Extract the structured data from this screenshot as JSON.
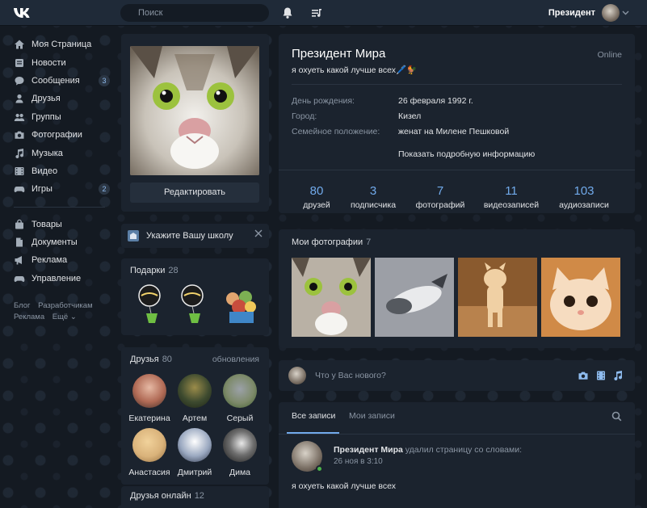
{
  "header": {
    "search_placeholder": "Поиск",
    "profile_name": "Президент"
  },
  "sidebar": {
    "items": [
      {
        "label": "Моя Страница",
        "icon": "home-icon"
      },
      {
        "label": "Новости",
        "icon": "news-icon"
      },
      {
        "label": "Сообщения",
        "icon": "messages-icon",
        "badge": "3"
      },
      {
        "label": "Друзья",
        "icon": "person-icon"
      },
      {
        "label": "Группы",
        "icon": "groups-icon"
      },
      {
        "label": "Фотографии",
        "icon": "camera-icon"
      },
      {
        "label": "Музыка",
        "icon": "music-icon"
      },
      {
        "label": "Видео",
        "icon": "video-icon"
      },
      {
        "label": "Игры",
        "icon": "gamepad-icon",
        "badge": "2"
      }
    ],
    "items2": [
      {
        "label": "Товары",
        "icon": "bag-icon"
      },
      {
        "label": "Документы",
        "icon": "document-icon"
      },
      {
        "label": "Реклама",
        "icon": "megaphone-icon"
      },
      {
        "label": "Управление",
        "icon": "gamepad-icon"
      }
    ],
    "footer": {
      "blog": "Блог",
      "developers": "Разработчикам",
      "ads": "Реклама",
      "more": "Ещё ⌄"
    }
  },
  "profile": {
    "edit_label": "Редактировать",
    "school_prompt": "Укажите Вашу школу",
    "gifts_title": "Подарки",
    "gifts_count": "28",
    "friends_title": "Друзья",
    "friends_count": "80",
    "friends_updates": "обновления",
    "friends": [
      {
        "name": "Екатерина",
        "color": "#c78a6a"
      },
      {
        "name": "Артем",
        "color": "#3d4a2f"
      },
      {
        "name": "Серый",
        "color": "#7d8a6a"
      },
      {
        "name": "Анастасия",
        "color": "#d9b27a"
      },
      {
        "name": "Дмитрий",
        "color": "#9aa8c0"
      },
      {
        "name": "Дима",
        "color": "#2c2c2c"
      }
    ],
    "online_title": "Друзья онлайн",
    "online_count": "12"
  },
  "info": {
    "name": "Президент Мира",
    "online": "Online",
    "status": "я охуеть какой лучше всех🖊️🐓",
    "rows": [
      {
        "label": "День рождения:",
        "value": "26 февраля 1992 г."
      },
      {
        "label": "Город:",
        "value": "Кизел"
      },
      {
        "label": "Семейное положение:",
        "value": "женат на Милене Пешковой"
      }
    ],
    "more": "Показать подробную информацию",
    "counters": [
      {
        "num": "80",
        "label": "друзей"
      },
      {
        "num": "3",
        "label": "подписчика"
      },
      {
        "num": "7",
        "label": "фотографий"
      },
      {
        "num": "11",
        "label": "видеозаписей"
      },
      {
        "num": "103",
        "label": "аудиозаписи"
      }
    ]
  },
  "photos": {
    "title": "Мои фотографии",
    "count": "7"
  },
  "post": {
    "placeholder": "Что у Вас нового?"
  },
  "wall": {
    "tab_all": "Все записи",
    "tab_mine": "Мои записи",
    "author": "Президент Мира",
    "action": "удалил страницу со словами:",
    "date": "26 ноя в 3:10",
    "text": "я охуеть какой лучше всех"
  },
  "colors": {
    "accent": "#71aaeb",
    "panel": "#1b232e",
    "header": "#1f2a38",
    "online_dot": "#4bb34b"
  }
}
